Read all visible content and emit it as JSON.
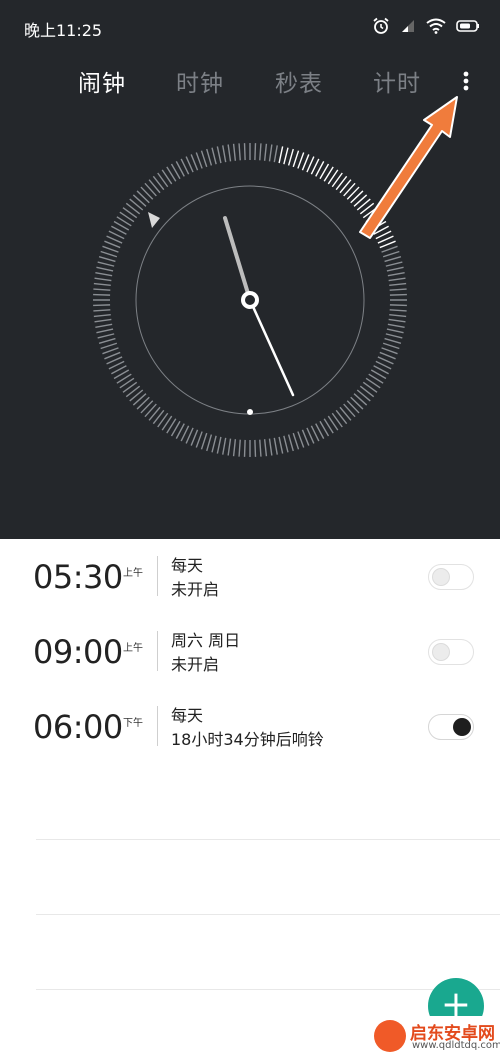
{
  "status_bar": {
    "time": "晚上11:25",
    "icons": [
      "alarm-icon",
      "signal-icon",
      "wifi-icon",
      "battery-icon"
    ]
  },
  "tabs": [
    {
      "label": "闹钟",
      "active": true
    },
    {
      "label": "时钟",
      "active": false
    },
    {
      "label": "秒表",
      "active": false
    },
    {
      "label": "计时",
      "active": false
    }
  ],
  "more_icon": "more-vertical-icon",
  "colors": {
    "header_bg": "#24272b",
    "active_tab": "#ffffff",
    "inactive_tab": "#7c8086",
    "annotation_arrow": "#f07c3c",
    "fab": "#19a88f"
  },
  "alarms": [
    {
      "time": "05:30",
      "ampm": "上午",
      "repeat": "每天",
      "status": "未开启",
      "enabled": false
    },
    {
      "time": "09:00",
      "ampm": "上午",
      "repeat": "周六 周日",
      "status": "未开启",
      "enabled": false
    },
    {
      "time": "06:00",
      "ampm": "下午",
      "repeat": "每天",
      "status": "18小时34分钟后响铃",
      "enabled": true
    }
  ],
  "fab": {
    "icon": "plus-icon",
    "label": "+"
  },
  "watermark": {
    "name": "启东安卓网",
    "url": "www.qdldtdq.com"
  }
}
